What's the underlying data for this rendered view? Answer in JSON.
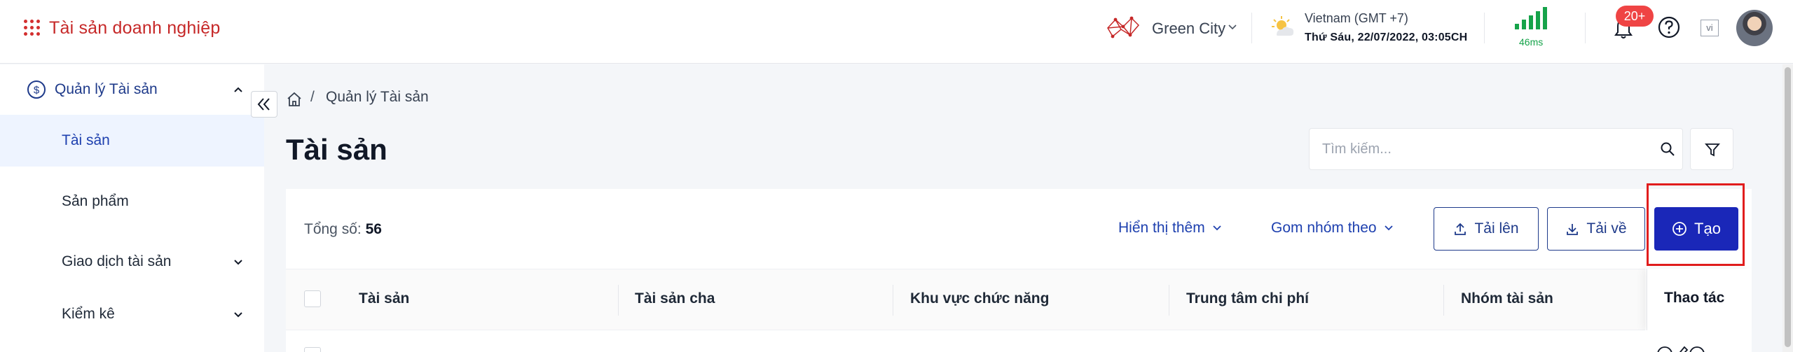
{
  "header": {
    "app_title": "Tài sản doanh nghiệp",
    "city": "Green City",
    "timezone": "Vietnam (GMT +7)",
    "datetime": "Thứ Sáu, 22/07/2022, 03:05CH",
    "latency": "46ms",
    "notification_count": "20+",
    "language": "vi",
    "icons": [
      "apps-grid-icon",
      "city-map-icon",
      "chevron-down-icon",
      "weather-icon",
      "signal-icon",
      "bell-icon",
      "help-icon",
      "language-icon",
      "avatar"
    ]
  },
  "sidebar": {
    "group_label": "Quản lý Tài sản",
    "items": [
      {
        "label": "Tài sản",
        "active": true
      },
      {
        "label": "Sản phẩm"
      },
      {
        "label": "Giao dịch tài sản",
        "expandable": true
      },
      {
        "label": "Kiểm kê",
        "expandable": true
      }
    ]
  },
  "breadcrumb": {
    "separator": "/",
    "current": "Quản lý Tài sản"
  },
  "page": {
    "title": "Tài sản"
  },
  "search": {
    "placeholder": "Tìm kiếm..."
  },
  "toolbar": {
    "total_label": "Tổng số:",
    "total_value": "56",
    "show_more": "Hiển thị thêm",
    "group_by": "Gom nhóm theo",
    "upload": "Tải lên",
    "download": "Tải về",
    "create": "Tạo"
  },
  "table": {
    "columns": [
      "Tài sản",
      "Tài sản cha",
      "Khu vực chức năng",
      "Trung tâm chi phí",
      "Nhóm tài sản"
    ],
    "actions_column": "Thao tác"
  },
  "colors": {
    "brand_red": "#c62828",
    "primary": "#1a27b8",
    "highlight": "#e11d1d",
    "signal_green": "#16a34a"
  }
}
